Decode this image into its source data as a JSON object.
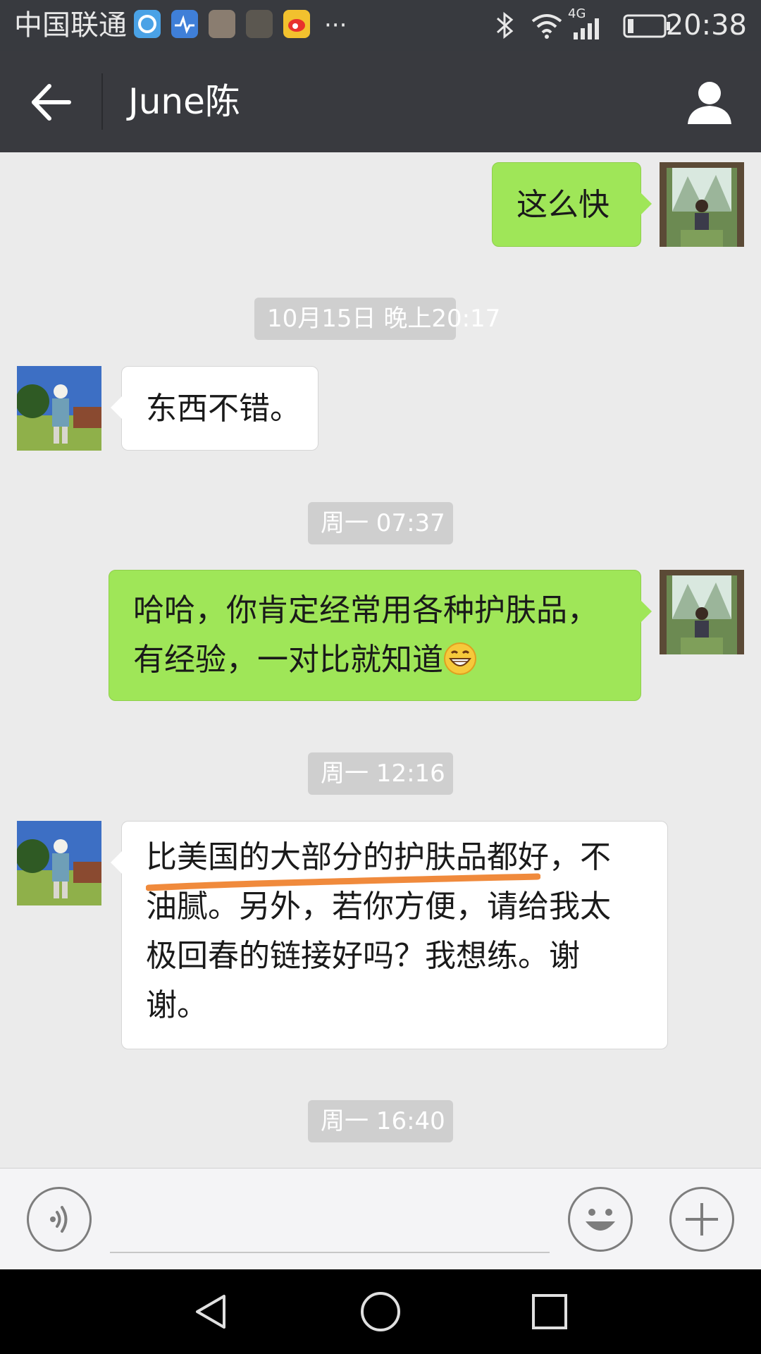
{
  "status_bar": {
    "carrier": "中国联通",
    "overflow": "···",
    "network": "4G",
    "time": "20:38",
    "icons": [
      "app-icon-1",
      "heart-rate-icon",
      "photo-icon",
      "photo-icon-2",
      "weibo-icon",
      "bluetooth-icon",
      "wifi-icon",
      "signal-icon",
      "battery-icon"
    ]
  },
  "header": {
    "title": "June陈",
    "icons": [
      "back-arrow-icon",
      "profile-icon"
    ]
  },
  "chat": {
    "messages": [
      {
        "type": "message",
        "direction": "outgoing",
        "text": "这么快"
      },
      {
        "type": "timestamp",
        "text": "10月15日 晚上20:17"
      },
      {
        "type": "message",
        "direction": "incoming",
        "text": "东西不错。"
      },
      {
        "type": "timestamp",
        "text": "周一 07:37"
      },
      {
        "type": "message",
        "direction": "outgoing",
        "line1": "哈哈，你肯定经常用各种护肤品，",
        "line2": "有经验，一对比就知道",
        "emoji": "grinning-face-icon"
      },
      {
        "type": "timestamp",
        "text": "周一 12:16"
      },
      {
        "type": "message",
        "direction": "incoming",
        "line1": "比美国的大部分的护肤品都好，不",
        "line2": "油腻。另外，若你方便，请给我太",
        "line3": "极回春的链接好吗？我想练。谢",
        "line4": "谢。",
        "annotation": "orange hand-drawn underline"
      },
      {
        "type": "timestamp",
        "text": "周一 16:40"
      }
    ]
  },
  "input_bar": {
    "icons": [
      "voice-icon",
      "emoji-icon",
      "plus-icon"
    ]
  },
  "nav_bar": {
    "icons": [
      "nav-back-icon",
      "nav-home-icon",
      "nav-recent-icon"
    ]
  },
  "colors": {
    "status_bar_bg": "#383a3f",
    "title_bar_bg": "#393a3f",
    "chat_bg": "#ebebeb",
    "outgoing_bubble": "#9fe658",
    "incoming_bubble": "#ffffff",
    "timestamp_bg": "#cfcfcf",
    "underline": "#f08a3c"
  }
}
